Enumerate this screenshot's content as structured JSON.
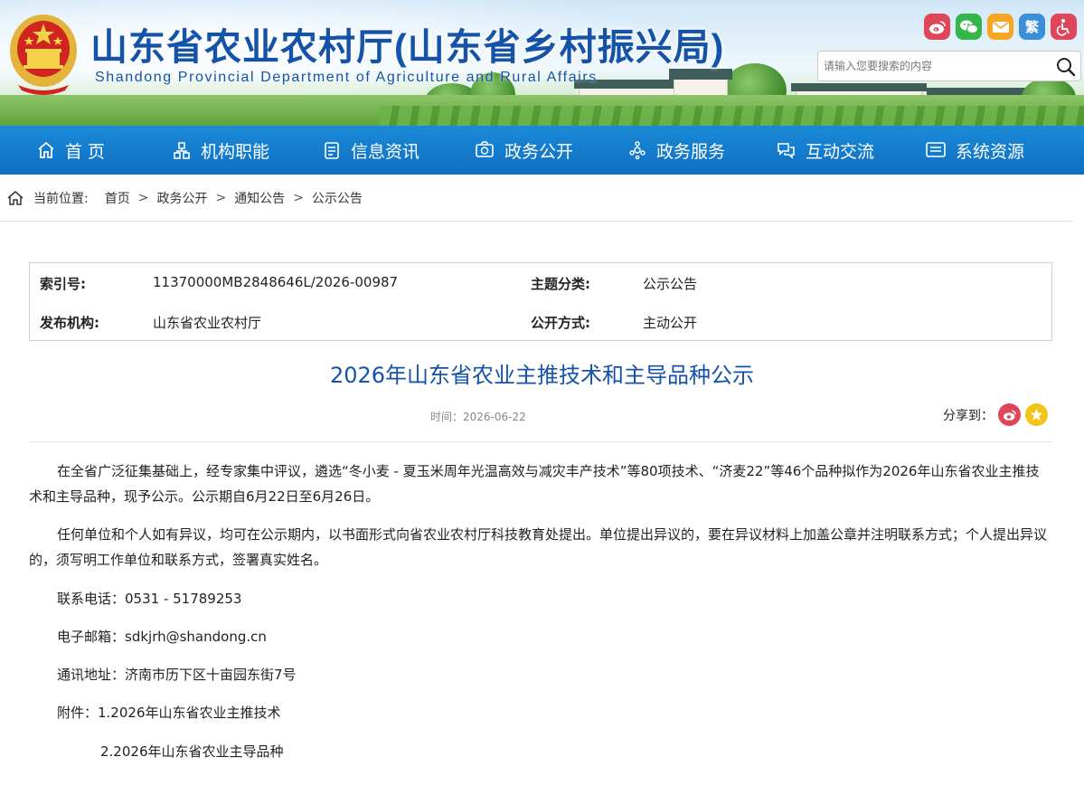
{
  "header": {
    "title": "山东省农业农村厅(山东省乡村振兴局)",
    "subtitle": "Shandong Provincial Department of Agriculture and Rural Affairs",
    "social": [
      {
        "name": "weibo",
        "color": "#e0465a"
      },
      {
        "name": "wechat",
        "color": "#33b64a"
      },
      {
        "name": "mail",
        "color": "#f5a623"
      },
      {
        "name": "traditional",
        "label": "繁",
        "color": "#3b8fd8"
      },
      {
        "name": "accessibility",
        "color": "#e0465a"
      }
    ],
    "search": {
      "placeholder": "请输入您要搜索的内容"
    }
  },
  "nav": {
    "items": [
      {
        "label": "首 页",
        "icon": "home-icon"
      },
      {
        "label": "机构职能",
        "icon": "org-icon"
      },
      {
        "label": "信息资讯",
        "icon": "news-icon"
      },
      {
        "label": "政务公开",
        "icon": "open-icon"
      },
      {
        "label": "政务服务",
        "icon": "service-icon"
      },
      {
        "label": "互动交流",
        "icon": "chat-icon"
      },
      {
        "label": "系统资源",
        "icon": "system-icon"
      }
    ]
  },
  "breadcrumb": {
    "label": "当前位置:",
    "items": [
      "首页",
      "政务公开",
      "通知公告",
      "公示公告"
    ],
    "separator": ">"
  },
  "meta": {
    "index_label": "索引号:",
    "index_value": "11370000MB2848646L/2026-00987",
    "category_label": "主题分类:",
    "category_value": "公示公告",
    "publisher_label": "发布机构:",
    "publisher_value": "山东省农业农村厅",
    "mode_label": "公开方式:",
    "mode_value": "主动公开"
  },
  "article": {
    "title": "2026年山东省农业主推技术和主导品种公示",
    "time": "时间：2026-06-22",
    "share_label": "分享到：",
    "paragraphs": [
      "在全省广泛征集基础上，经专家集中评议，遴选“冬小麦 - 夏玉米周年光温高效与减灾丰产技术”等80项技术、“济麦22”等46个品种拟作为2026年山东省农业主推技术和主导品种，现予公示。公示期自6月22日至6月26日。",
      "任何单位和个人如有异议，均可在公示期内，以书面形式向省农业农村厅科技教育处提出。单位提出异议的，要在异议材料上加盖公章并注明联系方式；个人提出异议的，须写明工作单位和联系方式，签署真实姓名。"
    ],
    "phone": "联系电话：0531 - 51789253",
    "email": "电子邮箱：sdkjrh@shandong.cn",
    "address": "通讯地址：济南市历下区十亩园东街7号",
    "attachment_1": "附件：1.2026年山东省农业主推技术",
    "attachment_2": "2.2026年山东省农业主导品种"
  }
}
